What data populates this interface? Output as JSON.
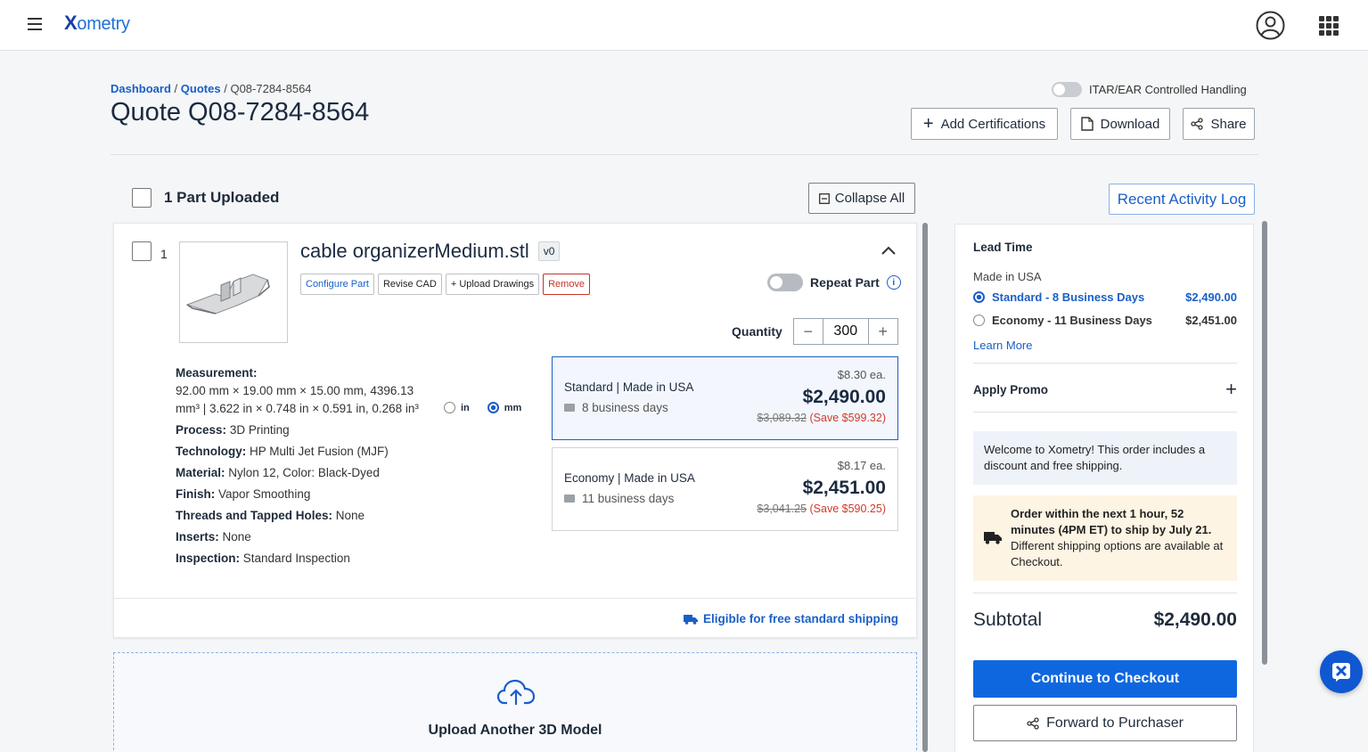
{
  "brand": {
    "logo_x": "X",
    "logo_rest": "ometry"
  },
  "breadcrumb": {
    "dashboard": "Dashboard",
    "sep1": "/",
    "quotes": "Quotes",
    "sep2": "/",
    "current": "Q08-7284-8564"
  },
  "page": {
    "title": "Quote Q08-7284-8564"
  },
  "itar": {
    "label": "ITAR/EAR Controlled Handling",
    "enabled": false
  },
  "header_buttons": {
    "add_certifications": "Add Certifications",
    "download": "Download",
    "share": "Share"
  },
  "parts": {
    "uploaded_label": "1 Part Uploaded",
    "collapse_all": "Collapse All",
    "recent_activity": "Recent Activity Log"
  },
  "part": {
    "index": "1",
    "name": "cable organizerMedium.stl",
    "version": "v0",
    "actions": {
      "configure": "Configure Part",
      "revise": "Revise CAD",
      "upload_drawings": "+ Upload Drawings",
      "remove": "Remove"
    },
    "repeat_label": "Repeat Part",
    "repeat_enabled": false,
    "quantity_label": "Quantity",
    "quantity": "300",
    "specs": {
      "measurement_label": "Measurement:",
      "measurement_value": "92.00 mm × 19.00 mm × 15.00 mm, 4396.13 mm³  |  3.622 in × 0.748 in × 0.591 in, 0.268 in³",
      "process_label": "Process:",
      "process": "3D Printing",
      "technology_label": "Technology:",
      "technology": "HP Multi Jet Fusion (MJF)",
      "material_label": "Material:",
      "material": "Nylon 12, Color: Black-Dyed",
      "finish_label": "Finish:",
      "finish": "Vapor Smoothing",
      "threads_label": "Threads and Tapped Holes:",
      "threads": "None",
      "inserts_label": "Inserts:",
      "inserts": "None",
      "inspection_label": "Inspection:",
      "inspection": "Standard Inspection"
    },
    "units": {
      "in": "in",
      "mm": "mm",
      "selected": "mm"
    },
    "pricing": [
      {
        "name": "Standard",
        "sep": " | ",
        "origin": "Made in USA",
        "days": "8 business days",
        "each": "$8.30 ea.",
        "total": "$2,490.00",
        "original": "$3,089.32",
        "save": "(Save $599.32)",
        "selected": true
      },
      {
        "name": "Economy",
        "sep": " | ",
        "origin": "Made in USA",
        "days": "11 business days",
        "each": "$8.17 ea.",
        "total": "$2,451.00",
        "original": "$3,041.25",
        "save": "(Save $590.25)",
        "selected": false
      }
    ],
    "free_shipping": "Eligible for free standard shipping"
  },
  "upload": {
    "title": "Upload Another 3D Model"
  },
  "sidebar": {
    "lead_time_title": "Lead Time",
    "made_in": "Made in USA",
    "options": [
      {
        "label": "Standard - 8 Business Days",
        "price": "$2,490.00",
        "selected": true
      },
      {
        "label": "Economy - 11 Business Days",
        "price": "$2,451.00",
        "selected": false
      }
    ],
    "learn_more": "Learn More",
    "apply_promo": "Apply Promo",
    "welcome": "Welcome to Xometry! This order includes a discount and free shipping.",
    "notice_bold": "Order within the next 1 hour, 52 minutes (4PM ET) to ship by July 21.",
    "notice_rest": " Different shipping options are available at Checkout.",
    "subtotal_label": "Subtotal",
    "subtotal_value": "$2,490.00",
    "checkout": "Continue to Checkout",
    "forward": "Forward to Purchaser"
  },
  "colors": {
    "primary": "#0f67e0",
    "link": "#1a5fc7",
    "danger": "#d23a2a",
    "notice_bg": "#fdf4e3",
    "welcome_bg": "#eef3fa"
  }
}
